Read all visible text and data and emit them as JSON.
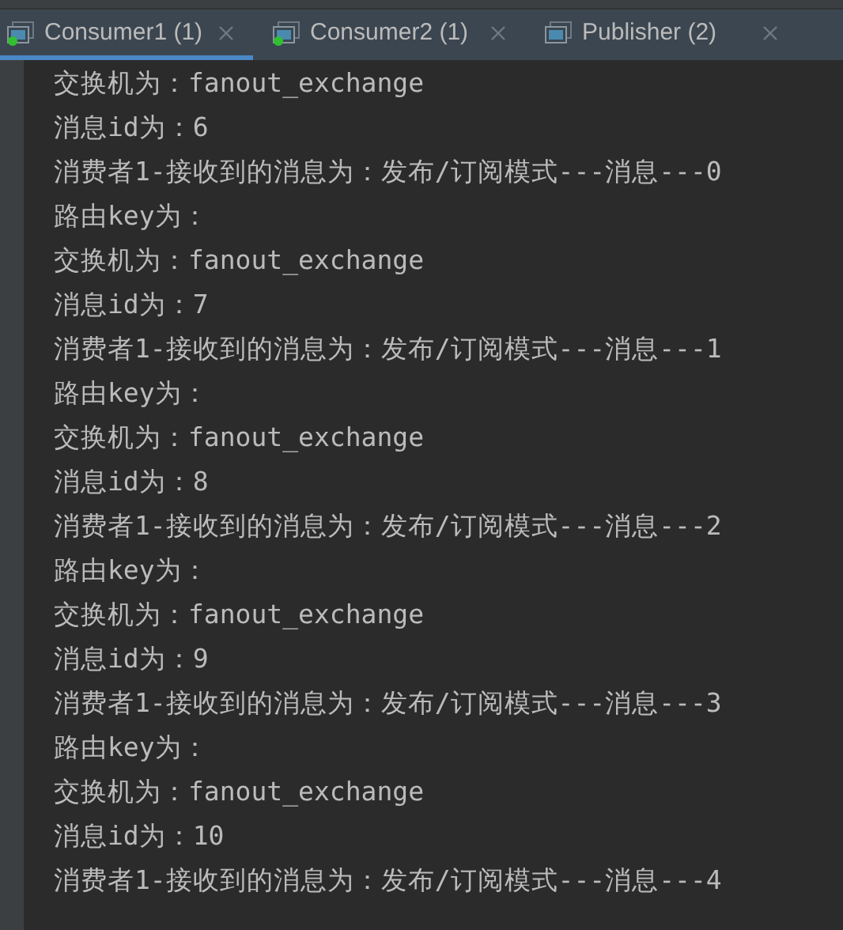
{
  "tabs": [
    {
      "label": "Consumer1 (1)",
      "selected": true,
      "running": true
    },
    {
      "label": "Consumer2 (1)",
      "selected": false,
      "running": true
    },
    {
      "label": "Publisher (2)",
      "selected": false,
      "running": false
    }
  ],
  "console_lines": [
    "交换机为：fanout_exchange",
    "消息id为：6",
    "消费者1-接收到的消息为：发布/订阅模式---消息---0",
    "路由key为：",
    "交换机为：fanout_exchange",
    "消息id为：7",
    "消费者1-接收到的消息为：发布/订阅模式---消息---1",
    "路由key为：",
    "交换机为：fanout_exchange",
    "消息id为：8",
    "消费者1-接收到的消息为：发布/订阅模式---消息---2",
    "路由key为：",
    "交换机为：fanout_exchange",
    "消息id为：9",
    "消费者1-接收到的消息为：发布/订阅模式---消息---3",
    "路由key为：",
    "交换机为：fanout_exchange",
    "消息id为：10",
    "消费者1-接收到的消息为：发布/订阅模式---消息---4"
  ]
}
